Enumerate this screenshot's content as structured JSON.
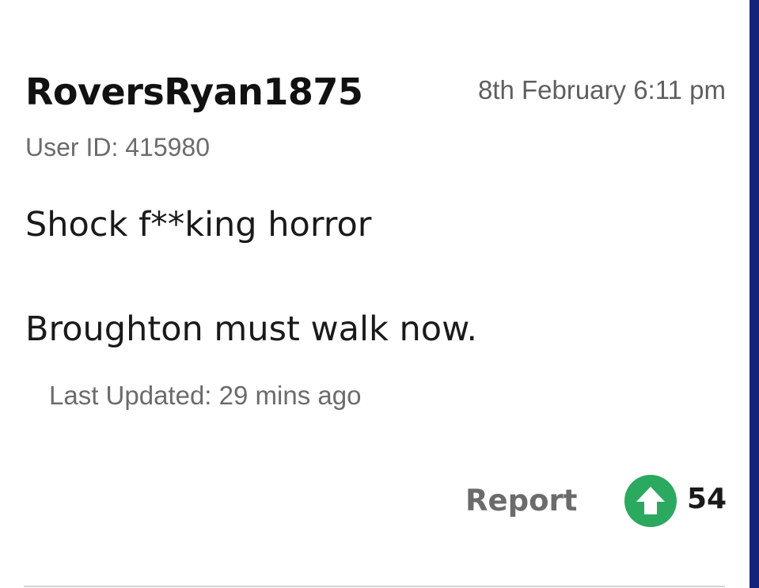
{
  "comment": {
    "username": "RoversRyan1875",
    "timestamp": "8th February 6:11 pm",
    "user_id": "User ID: 415980",
    "body_lines": [
      "Shock f**king horror",
      "Broughton must walk now."
    ],
    "last_updated": "Last Updated: 29 mins ago",
    "report_label": "Report",
    "upvote_icon": "arrow-up-icon",
    "upvote_count": "54"
  },
  "colors": {
    "side_bar": "#14237a",
    "upvote_green": "#2aa95f"
  }
}
